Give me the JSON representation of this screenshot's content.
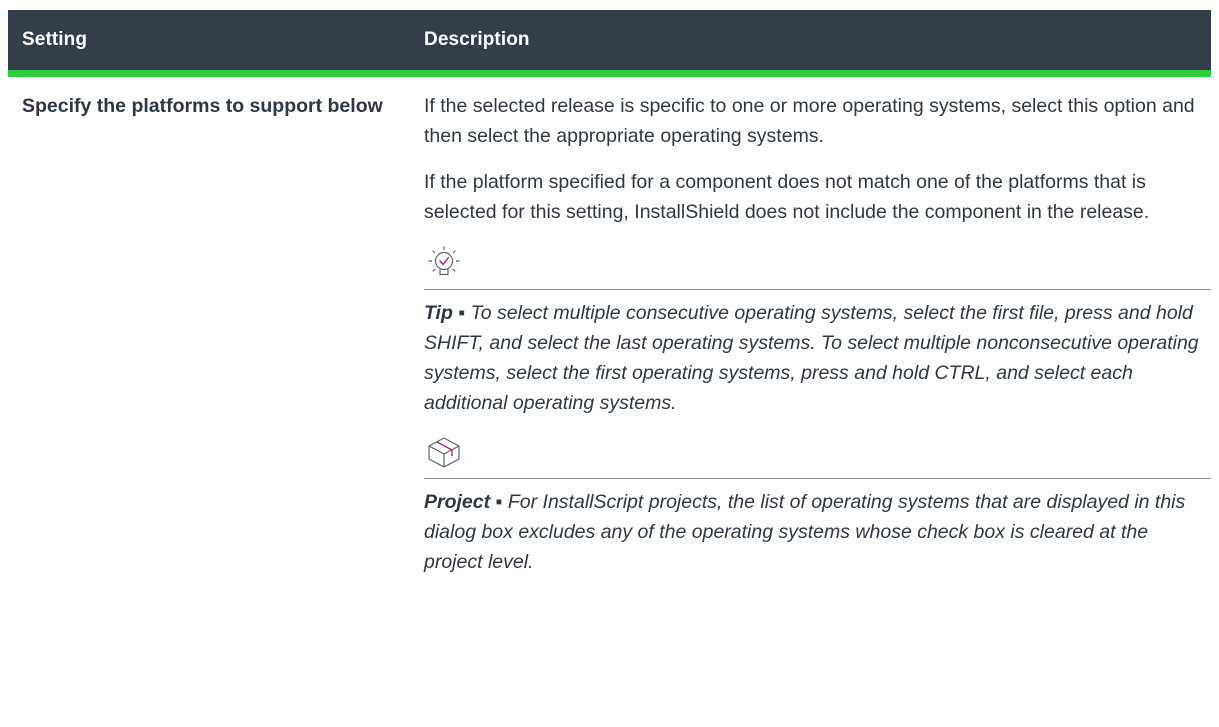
{
  "header": {
    "setting_label": "Setting",
    "description_label": "Description"
  },
  "row": {
    "setting": "Specify the platforms to support below",
    "paragraphs": [
      "If the selected release is specific to one or more operating systems, select this option and then select the appropriate operating systems.",
      "If the platform specified for a component does not match one of the platforms that is selected for this setting, InstallShield does not include the component in the release."
    ],
    "tip": {
      "icon": "lightbulb-check-icon",
      "lead": "Tip ▪",
      "text": " To select multiple consecutive operating systems, select the first file, press and hold SHIFT, and select the last operating systems. To select multiple nonconsecutive operating systems, select the first operating systems, press and hold CTRL, and select each additional operating systems."
    },
    "project": {
      "icon": "box-package-icon",
      "lead": "Project ▪",
      "text": " For InstallScript projects, the list of operating systems that are displayed in this dialog box excludes any of the operating systems whose check box is cleared at the project level."
    }
  },
  "colors": {
    "header_bg": "#333e48",
    "header_rule": "#2ecc40",
    "icon_accent": "#c2185b"
  }
}
